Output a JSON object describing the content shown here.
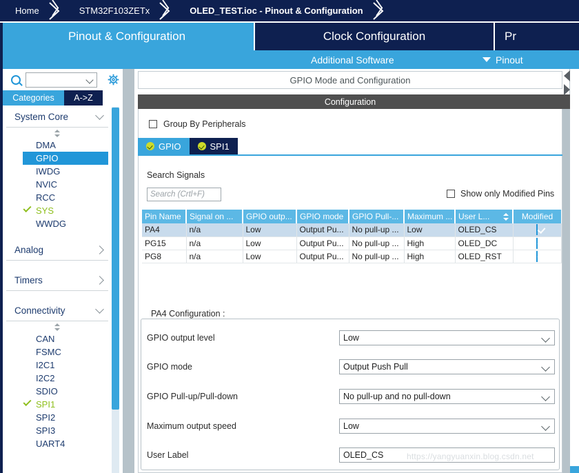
{
  "breadcrumb": {
    "items": [
      {
        "label": "Home",
        "active": false
      },
      {
        "label": "STM32F103ZETx",
        "active": false
      },
      {
        "label": "OLED_TEST.ioc - Pinout & Configuration",
        "active": true
      }
    ]
  },
  "main_tabs": [
    {
      "label": "Pinout & Configuration",
      "selected": true
    },
    {
      "label": "Clock Configuration",
      "selected": false
    },
    {
      "label": "Pr",
      "selected": false
    }
  ],
  "subbar": {
    "additional_software": "Additional Software",
    "pinout": "Pinout"
  },
  "sidebar": {
    "search_value": "",
    "search_placeholder": "",
    "gear_icon": "gear-icon",
    "search_icon": "search-icon",
    "tabs": [
      {
        "label": "Categories",
        "selected": true
      },
      {
        "label": "A->Z",
        "selected": false
      }
    ],
    "groups": [
      {
        "name": "System Core",
        "expanded": true,
        "items": [
          {
            "label": "DMA",
            "state": "none"
          },
          {
            "label": "GPIO",
            "state": "selected"
          },
          {
            "label": "IWDG",
            "state": "none"
          },
          {
            "label": "NVIC",
            "state": "none"
          },
          {
            "label": "RCC",
            "state": "none"
          },
          {
            "label": "SYS",
            "state": "configured"
          },
          {
            "label": "WWDG",
            "state": "none"
          }
        ]
      },
      {
        "name": "Analog",
        "expanded": false,
        "items": []
      },
      {
        "name": "Timers",
        "expanded": false,
        "items": []
      },
      {
        "name": "Connectivity",
        "expanded": true,
        "items": [
          {
            "label": "CAN",
            "state": "none"
          },
          {
            "label": "FSMC",
            "state": "none"
          },
          {
            "label": "I2C1",
            "state": "none"
          },
          {
            "label": "I2C2",
            "state": "none"
          },
          {
            "label": "SDIO",
            "state": "none"
          },
          {
            "label": "SPI1",
            "state": "configured"
          },
          {
            "label": "SPI2",
            "state": "none"
          },
          {
            "label": "SPI3",
            "state": "none"
          },
          {
            "label": "UART4",
            "state": "none"
          }
        ]
      }
    ]
  },
  "main": {
    "title": "GPIO Mode and Configuration",
    "configuration_header": "Configuration",
    "group_by_peripherals": {
      "label": "Group By Peripherals",
      "checked": false
    },
    "peripheral_tabs": [
      {
        "label": "GPIO",
        "selected": true,
        "status": "ok"
      },
      {
        "label": "SPI1",
        "selected": false,
        "status": "ok"
      }
    ],
    "search_signals": {
      "label": "Search Signals",
      "value": "",
      "placeholder": "Search (Crtl+F)"
    },
    "show_only_modified": {
      "label": "Show only Modified Pins",
      "checked": false
    },
    "table": {
      "columns": [
        "Pin Name",
        "Signal on ...",
        "GPIO outp...",
        "GPIO mode",
        "GPIO Pull-...",
        "Maximum ...",
        "User L...",
        "Modified"
      ],
      "sort_column_index": 6,
      "rows": [
        {
          "selected": true,
          "cells": [
            "PA4",
            "n/a",
            "Low",
            "Output Pu...",
            "No pull-up ...",
            "Low",
            "OLED_CS",
            ""
          ],
          "modified": true
        },
        {
          "selected": false,
          "cells": [
            "PG15",
            "n/a",
            "Low",
            "Output Pu...",
            "No pull-up ...",
            "High",
            "OLED_DC",
            ""
          ],
          "modified": true
        },
        {
          "selected": false,
          "cells": [
            "PG8",
            "n/a",
            "Low",
            "Output Pu...",
            "No pull-up ...",
            "High",
            "OLED_RST",
            ""
          ],
          "modified": true
        }
      ]
    },
    "pin_config": {
      "legend": "PA4 Configuration :",
      "fields": [
        {
          "label": "GPIO output level",
          "value": "Low",
          "type": "combo"
        },
        {
          "label": "GPIO mode",
          "value": "Output Push Pull",
          "type": "combo"
        },
        {
          "label": "GPIO Pull-up/Pull-down",
          "value": "No pull-up and no pull-down",
          "type": "combo"
        },
        {
          "label": "Maximum output speed",
          "value": "Low",
          "type": "combo"
        },
        {
          "label": "User Label",
          "value": "OLED_CS",
          "type": "text"
        }
      ]
    }
  },
  "watermark": "https://yangyuanxin.blog.csdn.net",
  "colors": {
    "navy": "#0e2050",
    "accent_blue": "#39a5dc",
    "header_gray": "#4f4f4f",
    "table_header": "#5cb8e5",
    "selected_row": "#c8dbec",
    "configured_green": "#8fbf1e"
  }
}
